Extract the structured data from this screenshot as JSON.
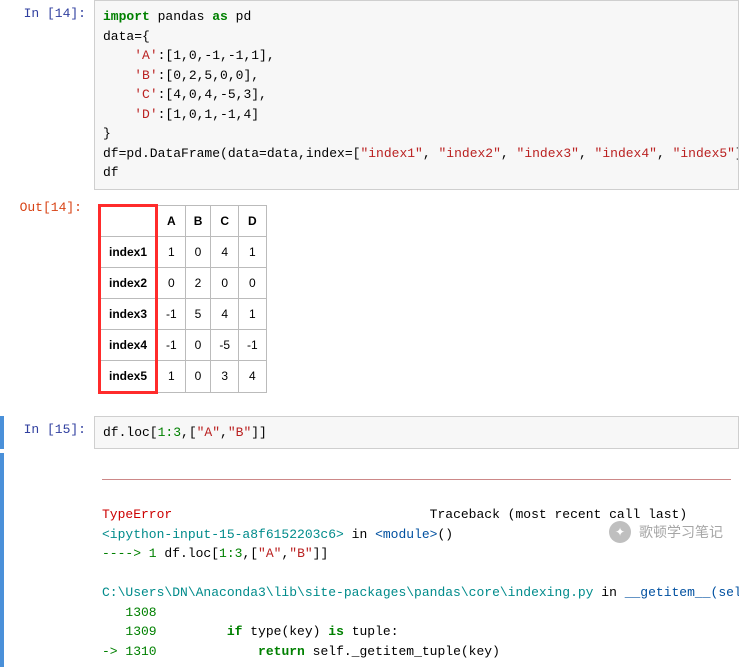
{
  "cells": {
    "cell14": {
      "prompt_in": "In  [14]:",
      "prompt_out": "Out[14]:",
      "code": {
        "line1_kw1": "import",
        "line1_mod": " pandas ",
        "line1_kw2": "as",
        "line1_alias": " pd",
        "line2": "data={",
        "line3_key": "'A'",
        "line3_rest": ":[1,0,-1,-1,1],",
        "line4_key": "'B'",
        "line4_rest": ":[0,2,5,0,0],",
        "line5_key": "'C'",
        "line5_rest": ":[4,0,4,-5,3],",
        "line6_key": "'D'",
        "line6_rest": ":[1,0,1,-1,4]",
        "line7": "}",
        "line8_pre": "df=pd.DataFrame(data=data,index=[",
        "line8_s1": "\"index1\"",
        "line8_s2": "\"index2\"",
        "line8_s3": "\"index3\"",
        "line8_s4": "\"index4\"",
        "line8_s5": "\"index5\"",
        "line8_sep": ", ",
        "line8_post": "])",
        "line9": "df"
      },
      "table": {
        "cols": [
          "A",
          "B",
          "C",
          "D"
        ],
        "index": [
          "index1",
          "index2",
          "index3",
          "index4",
          "index5"
        ],
        "rows": [
          [
            "1",
            "0",
            "4",
            "1"
          ],
          [
            "0",
            "2",
            "0",
            "0"
          ],
          [
            "-1",
            "5",
            "4",
            "1"
          ],
          [
            "-1",
            "0",
            "-5",
            "-1"
          ],
          [
            "1",
            "0",
            "3",
            "4"
          ]
        ]
      }
    },
    "cell15": {
      "prompt_in": "In  [15]:",
      "code_pre": "df.loc[",
      "code_slice": "1:3",
      "code_mid": ",[",
      "code_s1": "\"A\"",
      "code_sep": ",",
      "code_s2": "\"B\"",
      "code_post": "]]",
      "err": {
        "name": "TypeError",
        "traceback": "Traceback (most recent call last)",
        "frame1_pre": "<ipython-input-15-a8f6152203c6>",
        "frame1_in": " in ",
        "frame1_mod": "<module>",
        "frame1_post": "()",
        "arrow": "----> 1",
        "arrow_code_pre": " df.loc[",
        "arrow_code_slice": "1:3",
        "arrow_code_mid": ",[",
        "arrow_code_s1": "\"A\"",
        "arrow_code_sep": ",",
        "arrow_code_s2": "\"B\"",
        "arrow_code_post": "]]",
        "file": "C:\\Users\\DN\\Anaconda3\\lib\\site-packages\\pandas\\core\\indexing.py",
        "file_in": " in ",
        "func": "__getitem__",
        "sig": "(self, key)",
        "l1308": "   1308 ",
        "l1309_num": "   1309 ",
        "l1309_if": "if",
        "l1309_rest1": " type(key) ",
        "l1309_is": "is",
        "l1309_rest2": " tuple:",
        "l1310_arrow": "-> 1310 ",
        "l1310_ret": "return",
        "l1310_rest": " self._getitem_tuple(key)"
      }
    }
  },
  "watermark": "歌顿学习笔记"
}
